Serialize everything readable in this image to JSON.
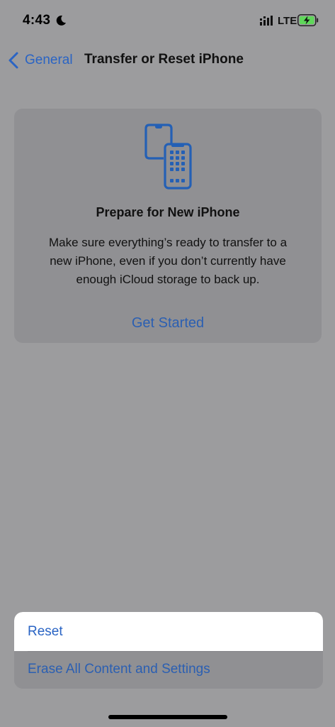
{
  "status_bar": {
    "time": "4:43",
    "network": "LTE",
    "icons": [
      "moon-icon",
      "signal-icon",
      "battery-charging-icon"
    ]
  },
  "nav": {
    "back_label": "General",
    "title": "Transfer or Reset iPhone"
  },
  "prepare_card": {
    "icon": "phones-transfer-icon",
    "title": "Prepare for New iPhone",
    "description_lines": [
      "Make sure everything’s ready to transfer to a",
      "new iPhone, even if you don’t currently have",
      "enough iCloud storage to back up."
    ],
    "action_label": "Get Started"
  },
  "bottom_actions": {
    "reset_label": "Reset",
    "erase_label": "Erase All Content and Settings"
  },
  "colors": {
    "accent_blue": "#2a64c4",
    "dimmed_background": "#9c9c9e",
    "card_background": "#909093",
    "battery_charging": "#5fd75a"
  }
}
